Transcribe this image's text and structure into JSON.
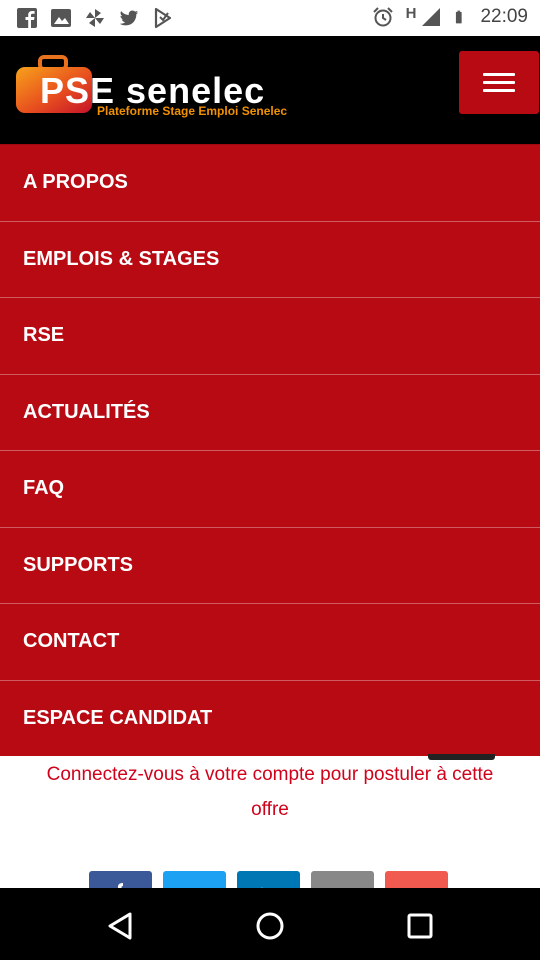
{
  "status_bar": {
    "time": "22:09",
    "network_label": "H",
    "left_icons": [
      "facebook-icon",
      "gallery-icon",
      "pinwheel-icon",
      "twitter-icon",
      "play-store-icon"
    ],
    "right_icons": [
      "alarm-icon",
      "signal-icon",
      "battery-icon"
    ]
  },
  "header": {
    "logo_text": "PSE senelec",
    "tagline": "Plateforme Stage Emploi Senelec",
    "menu_button_icon": "hamburger-icon"
  },
  "menu": {
    "items": [
      {
        "label": "A PROPOS"
      },
      {
        "label": "EMPLOIS & STAGES"
      },
      {
        "label": "RSE"
      },
      {
        "label": "ACTUALITÉS"
      },
      {
        "label": "FAQ"
      },
      {
        "label": "SUPPORTS"
      },
      {
        "label": "CONTACT"
      },
      {
        "label": "ESPACE CANDIDAT"
      }
    ]
  },
  "content": {
    "login_message": "Connectez-vous à votre compte pour postuler à cette offre"
  },
  "share_buttons": [
    {
      "icon": "facebook-icon",
      "color": "#3b5998"
    },
    {
      "icon": "twitter-icon",
      "color": "#1da1f2"
    },
    {
      "icon": "linkedin-icon",
      "color": "#0077b5"
    },
    {
      "icon": "email-icon",
      "color": "#888888"
    },
    {
      "icon": "more-share-icon",
      "color": "#f05a4f"
    }
  ],
  "nav_bar": {
    "buttons": [
      "back-icon",
      "home-icon",
      "recents-icon"
    ]
  },
  "colors": {
    "brand_red": "#b70a13",
    "header_bg": "#000000",
    "accent_orange": "#f29100",
    "message_red": "#d0021b"
  }
}
